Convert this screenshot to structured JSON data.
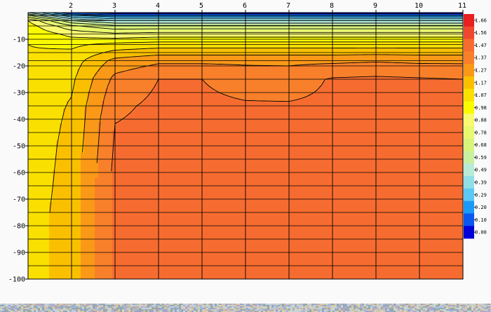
{
  "chart_data": {
    "type": "heatmap",
    "title": "",
    "xlabel": "",
    "ylabel": "",
    "x_ticks": [
      "2",
      "3",
      "4",
      "5",
      "6",
      "7",
      "8",
      "9",
      "10",
      "11"
    ],
    "y_ticks": [
      "-10",
      "-20",
      "-30",
      "-40",
      "-50",
      "-60",
      "-70",
      "-80",
      "-90",
      "-100"
    ],
    "x_tick_values": [
      2,
      3,
      4,
      5,
      6,
      7,
      8,
      9,
      10,
      11
    ],
    "y_tick_values": [
      -10,
      -20,
      -30,
      -40,
      -50,
      -60,
      -70,
      -80,
      -90,
      -100
    ],
    "xlim": [
      1,
      11
    ],
    "ylim": [
      -100,
      0
    ],
    "colorbar": {
      "labels": [
        "1.66",
        "1.56",
        "1.47",
        "1.37",
        "1.27",
        "1.17",
        "1.07",
        "0.98",
        "0.88",
        "0.78",
        "0.68",
        "0.59",
        "0.49",
        "0.39",
        "0.29",
        "0.20",
        "0.10",
        "0.00"
      ],
      "levels": [
        0.0,
        0.1,
        0.2,
        0.29,
        0.39,
        0.49,
        0.59,
        0.68,
        0.78,
        0.88,
        0.98,
        1.07,
        1.17,
        1.27,
        1.37,
        1.47,
        1.56,
        1.66
      ],
      "colors": [
        "#0000d8",
        "#0a58f0",
        "#1a9af8",
        "#5cc8f4",
        "#90dfe8",
        "#b8ecd8",
        "#c8f0a0",
        "#d8f47c",
        "#e8f870",
        "#fafa70",
        "#fafa00",
        "#fae000",
        "#fac000",
        "#fa9818",
        "#f8802a",
        "#f66c30",
        "#f04830",
        "#e82020"
      ]
    },
    "grid": true,
    "columns": [
      {
        "x": 1.0,
        "depth": [
          0,
          -1,
          -3,
          -5,
          -8,
          -12,
          -18,
          -25,
          -35,
          -45,
          -55,
          -65,
          -75,
          -85,
          -100
        ],
        "value": [
          0.49,
          0.68,
          0.98,
          1.03,
          1.06,
          1.07,
          1.08,
          1.1,
          1.11,
          1.12,
          1.12,
          1.13,
          1.13,
          1.13,
          1.13
        ]
      },
      {
        "x": 2.0,
        "depth": [
          0,
          -1,
          -3,
          -5,
          -8,
          -12,
          -18,
          -25,
          -35,
          -45,
          -55,
          -65,
          -75,
          -85,
          -100
        ],
        "value": [
          0.1,
          0.29,
          0.59,
          0.8,
          0.95,
          1.05,
          1.12,
          1.15,
          1.18,
          1.19,
          1.2,
          1.2,
          1.21,
          1.21,
          1.21
        ]
      },
      {
        "x": 3.0,
        "depth": [
          0,
          -1,
          -3,
          -5,
          -8,
          -12,
          -18,
          -25,
          -35,
          -45,
          -55,
          -65,
          -75,
          -85,
          -100
        ],
        "value": [
          0.05,
          0.2,
          0.49,
          0.7,
          0.9,
          1.1,
          1.3,
          1.4,
          1.45,
          1.48,
          1.49,
          1.5,
          1.5,
          1.5,
          1.5
        ]
      },
      {
        "x": 4.0,
        "depth": [
          0,
          -1,
          -3,
          -5,
          -8,
          -12,
          -18,
          -25,
          -35,
          -45,
          -55,
          -65,
          -75,
          -85,
          -100
        ],
        "value": [
          0.05,
          0.2,
          0.49,
          0.7,
          0.92,
          1.12,
          1.35,
          1.47,
          1.49,
          1.5,
          1.5,
          1.5,
          1.5,
          1.5,
          1.5
        ]
      },
      {
        "x": 5.0,
        "depth": [
          0,
          -1,
          -3,
          -5,
          -8,
          -12,
          -18,
          -25,
          -35,
          -45,
          -55,
          -65,
          -75,
          -85,
          -100
        ],
        "value": [
          0.05,
          0.2,
          0.49,
          0.7,
          0.92,
          1.12,
          1.35,
          1.47,
          1.49,
          1.5,
          1.5,
          1.5,
          1.5,
          1.5,
          1.5
        ]
      },
      {
        "x": 6.0,
        "depth": [
          0,
          -1,
          -3,
          -5,
          -8,
          -12,
          -18,
          -25,
          -35,
          -45,
          -55,
          -65,
          -75,
          -85,
          -100
        ],
        "value": [
          0.05,
          0.2,
          0.49,
          0.7,
          0.92,
          1.12,
          1.35,
          1.43,
          1.48,
          1.5,
          1.5,
          1.5,
          1.5,
          1.5,
          1.5
        ]
      },
      {
        "x": 7.0,
        "depth": [
          0,
          -1,
          -3,
          -5,
          -8,
          -12,
          -18,
          -25,
          -35,
          -45,
          -55,
          -65,
          -75,
          -85,
          -100
        ],
        "value": [
          0.05,
          0.2,
          0.49,
          0.7,
          0.92,
          1.12,
          1.35,
          1.42,
          1.48,
          1.5,
          1.5,
          1.5,
          1.5,
          1.5,
          1.5
        ]
      },
      {
        "x": 8.0,
        "depth": [
          0,
          -1,
          -3,
          -5,
          -8,
          -12,
          -18,
          -25,
          -35,
          -45,
          -55,
          -65,
          -75,
          -85,
          -100
        ],
        "value": [
          0.05,
          0.2,
          0.49,
          0.7,
          0.92,
          1.12,
          1.35,
          1.48,
          1.49,
          1.5,
          1.5,
          1.5,
          1.5,
          1.5,
          1.5
        ]
      },
      {
        "x": 9.0,
        "depth": [
          0,
          -1,
          -3,
          -5,
          -8,
          -12,
          -18,
          -25,
          -35,
          -45,
          -55,
          -65,
          -75,
          -85,
          -100
        ],
        "value": [
          0.05,
          0.2,
          0.49,
          0.7,
          0.92,
          1.12,
          1.36,
          1.49,
          1.5,
          1.5,
          1.5,
          1.5,
          1.5,
          1.5,
          1.5
        ]
      },
      {
        "x": 10.0,
        "depth": [
          0,
          -1,
          -3,
          -5,
          -8,
          -12,
          -18,
          -25,
          -35,
          -45,
          -55,
          -65,
          -75,
          -85,
          -100
        ],
        "value": [
          0.05,
          0.2,
          0.49,
          0.7,
          0.92,
          1.12,
          1.35,
          1.48,
          1.49,
          1.5,
          1.5,
          1.5,
          1.5,
          1.5,
          1.5
        ]
      },
      {
        "x": 11.0,
        "depth": [
          0,
          -1,
          -3,
          -5,
          -8,
          -12,
          -18,
          -25,
          -35,
          -45,
          -55,
          -65,
          -75,
          -85,
          -100
        ],
        "value": [
          0.05,
          0.2,
          0.49,
          0.7,
          0.92,
          1.12,
          1.35,
          1.47,
          1.49,
          1.5,
          1.5,
          1.5,
          1.5,
          1.5,
          1.5
        ]
      }
    ]
  },
  "footer": {
    "noise_colors": [
      "#8fa8c8",
      "#c8c0a8",
      "#a8b8d8",
      "#d8c8b0",
      "#98a8a0",
      "#c0d0e0",
      "#b8a8c0",
      "#d0d8c0"
    ]
  }
}
